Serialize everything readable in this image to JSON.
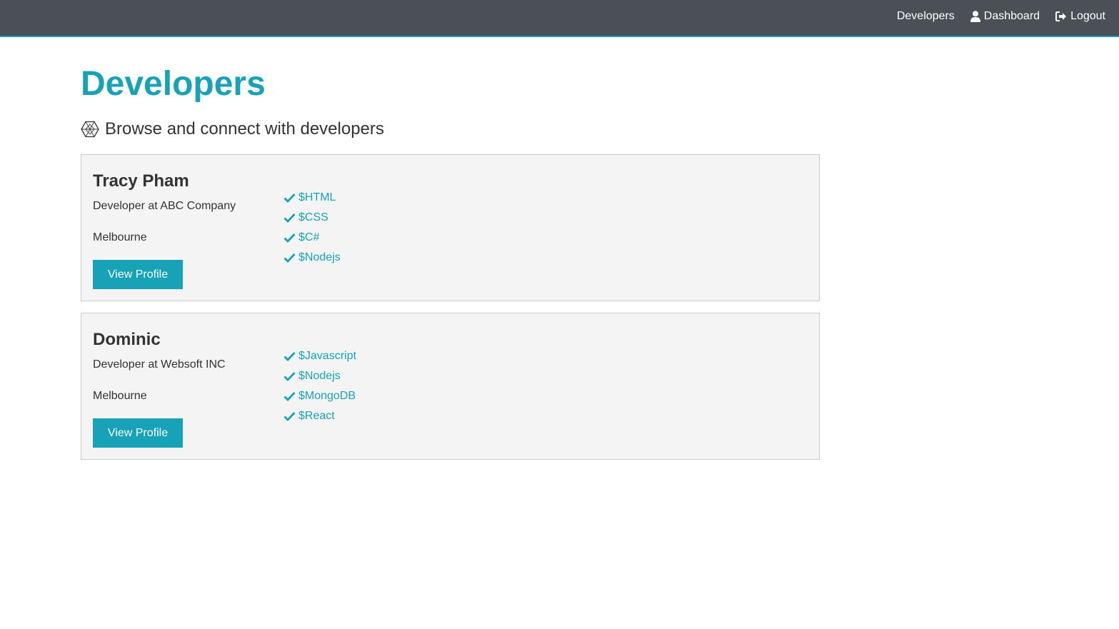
{
  "colors": {
    "accent": "#17a2b8",
    "navbar": "#4a5055",
    "card_background": "#f4f4f4"
  },
  "navbar": {
    "links": [
      {
        "label": "Developers",
        "icon": ""
      },
      {
        "label": "Dashboard",
        "icon": "user-icon"
      },
      {
        "label": "Logout",
        "icon": "sign-out-icon"
      }
    ]
  },
  "page": {
    "title": "Developers",
    "lead": "Browse and connect with developers",
    "lead_icon": "hexagon-icon"
  },
  "profiles": [
    {
      "name": "Tracy Pham",
      "status": "Developer at ABC Company",
      "location": "Melbourne",
      "button_label": "View Profile",
      "skills": [
        "$HTML",
        "$CSS",
        "$C#",
        "$Nodejs"
      ]
    },
    {
      "name": "Dominic",
      "status": "Developer at Websoft INC",
      "location": "Melbourne",
      "button_label": "View Profile",
      "skills": [
        "$Javascript",
        "$Nodejs",
        "$MongoDB",
        "$React"
      ]
    }
  ]
}
